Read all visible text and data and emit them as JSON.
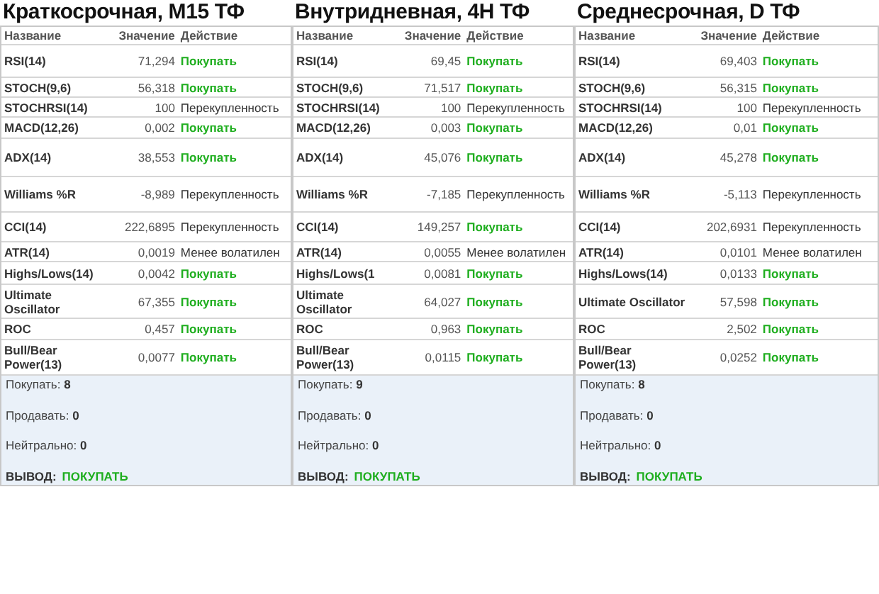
{
  "panels": [
    {
      "title": "Краткосрочная, M15 ТФ",
      "columns": [
        "Название",
        "Значение",
        "Действие"
      ],
      "rows": [
        {
          "name": "RSI(14)",
          "value": "71,294",
          "action": "Покупать",
          "kind": "buy"
        },
        {
          "name": "STOCH(9,6)",
          "value": "56,318",
          "action": "Покупать",
          "kind": "buy"
        },
        {
          "name": "STOCHRSI(14)",
          "value": "100",
          "action": "Перекупленность",
          "kind": "neutral"
        },
        {
          "name": "MACD(12,26)",
          "value": "0,002",
          "action": "Покупать",
          "kind": "buy"
        },
        {
          "name": "ADX(14)",
          "value": "38,553",
          "action": "Покупать",
          "kind": "buy"
        },
        {
          "name": "Williams %R",
          "value": "-8,989",
          "action": "Перекупленность",
          "kind": "neutral"
        },
        {
          "name": "CCI(14)",
          "value": "222,6895",
          "action": "Перекупленность",
          "kind": "neutral"
        },
        {
          "name": "ATR(14)",
          "value": "0,0019",
          "action": "Менее волатилен",
          "kind": "neutral"
        },
        {
          "name": "Highs/Lows(14)",
          "value": "0,0042",
          "action": "Покупать",
          "kind": "buy"
        },
        {
          "name": "Ultimate Oscillator",
          "value": "67,355",
          "action": "Покупать",
          "kind": "buy"
        },
        {
          "name": "ROC",
          "value": "0,457",
          "action": "Покупать",
          "kind": "buy"
        },
        {
          "name": "Bull/Bear Power(13)",
          "value": "0,0077",
          "action": "Покупать",
          "kind": "buy"
        }
      ],
      "summary": [
        {
          "label": "Покупать:",
          "count": "8"
        },
        {
          "label": "Продавать:",
          "count": "0"
        },
        {
          "label": "Нейтрально:",
          "count": "0"
        }
      ],
      "conclusion": {
        "label": "ВЫВОД:",
        "value": "ПОКУПАТЬ"
      }
    },
    {
      "title": "Внутридневная, 4H ТФ",
      "columns": [
        "Название",
        "Значение",
        "Действие"
      ],
      "rows": [
        {
          "name": "RSI(14)",
          "value": "69,45",
          "action": "Покупать",
          "kind": "buy"
        },
        {
          "name": "STOCH(9,6)",
          "value": "71,517",
          "action": "Покупать",
          "kind": "buy"
        },
        {
          "name": "STOCHRSI(14)",
          "value": "100",
          "action": "Перекупленность",
          "kind": "neutral"
        },
        {
          "name": "MACD(12,26)",
          "value": "0,003",
          "action": "Покупать",
          "kind": "buy"
        },
        {
          "name": "ADX(14)",
          "value": "45,076",
          "action": "Покупать",
          "kind": "buy"
        },
        {
          "name": "Williams %R",
          "value": "-7,185",
          "action": "Перекупленность",
          "kind": "neutral"
        },
        {
          "name": "CCI(14)",
          "value": "149,257",
          "action": "Покупать",
          "kind": "buy"
        },
        {
          "name": "ATR(14)",
          "value": "0,0055",
          "action": "Менее волатилен",
          "kind": "neutral"
        },
        {
          "name": "Highs/Lows(1",
          "value": "0,0081",
          "action": "Покупать",
          "kind": "buy"
        },
        {
          "name": "Ultimate Oscillator",
          "value": "64,027",
          "action": "Покупать",
          "kind": "buy"
        },
        {
          "name": "ROC",
          "value": "0,963",
          "action": "Покупать",
          "kind": "buy"
        },
        {
          "name": "Bull/Bear Power(13)",
          "value": "0,0115",
          "action": "Покупать",
          "kind": "buy"
        }
      ],
      "summary": [
        {
          "label": "Покупать:",
          "count": "9"
        },
        {
          "label": "Продавать:",
          "count": "0"
        },
        {
          "label": "Нейтрально:",
          "count": "0"
        }
      ],
      "conclusion": {
        "label": "ВЫВОД:",
        "value": "ПОКУПАТЬ"
      }
    },
    {
      "title": "Среднесрочная, D ТФ",
      "columns": [
        "Название",
        "Значение",
        "Действие"
      ],
      "rows": [
        {
          "name": "RSI(14)",
          "value": "69,403",
          "action": "Покупать",
          "kind": "buy"
        },
        {
          "name": "STOCH(9,6)",
          "value": "56,315",
          "action": "Покупать",
          "kind": "buy"
        },
        {
          "name": "STOCHRSI(14)",
          "value": "100",
          "action": "Перекупленность",
          "kind": "neutral"
        },
        {
          "name": "MACD(12,26)",
          "value": "0,01",
          "action": "Покупать",
          "kind": "buy"
        },
        {
          "name": "ADX(14)",
          "value": "45,278",
          "action": "Покупать",
          "kind": "buy"
        },
        {
          "name": "Williams %R",
          "value": "-5,113",
          "action": "Перекупленность",
          "kind": "neutral"
        },
        {
          "name": "CCI(14)",
          "value": "202,6931",
          "action": "Перекупленность",
          "kind": "neutral"
        },
        {
          "name": "ATR(14)",
          "value": "0,0101",
          "action": "Менее волатилен",
          "kind": "neutral"
        },
        {
          "name": "Highs/Lows(14)",
          "value": "0,0133",
          "action": "Покупать",
          "kind": "buy"
        },
        {
          "name": "Ultimate Oscillator",
          "value": "57,598",
          "action": "Покупать",
          "kind": "buy"
        },
        {
          "name": "ROC",
          "value": "2,502",
          "action": "Покупать",
          "kind": "buy"
        },
        {
          "name": "Bull/Bear Power(13)",
          "value": "0,0252",
          "action": "Покупать",
          "kind": "buy"
        }
      ],
      "summary": [
        {
          "label": "Покупать:",
          "count": "8"
        },
        {
          "label": "Продавать:",
          "count": "0"
        },
        {
          "label": "Нейтрально:",
          "count": "0"
        }
      ],
      "conclusion": {
        "label": "ВЫВОД:",
        "value": "ПОКУПАТЬ"
      }
    }
  ]
}
